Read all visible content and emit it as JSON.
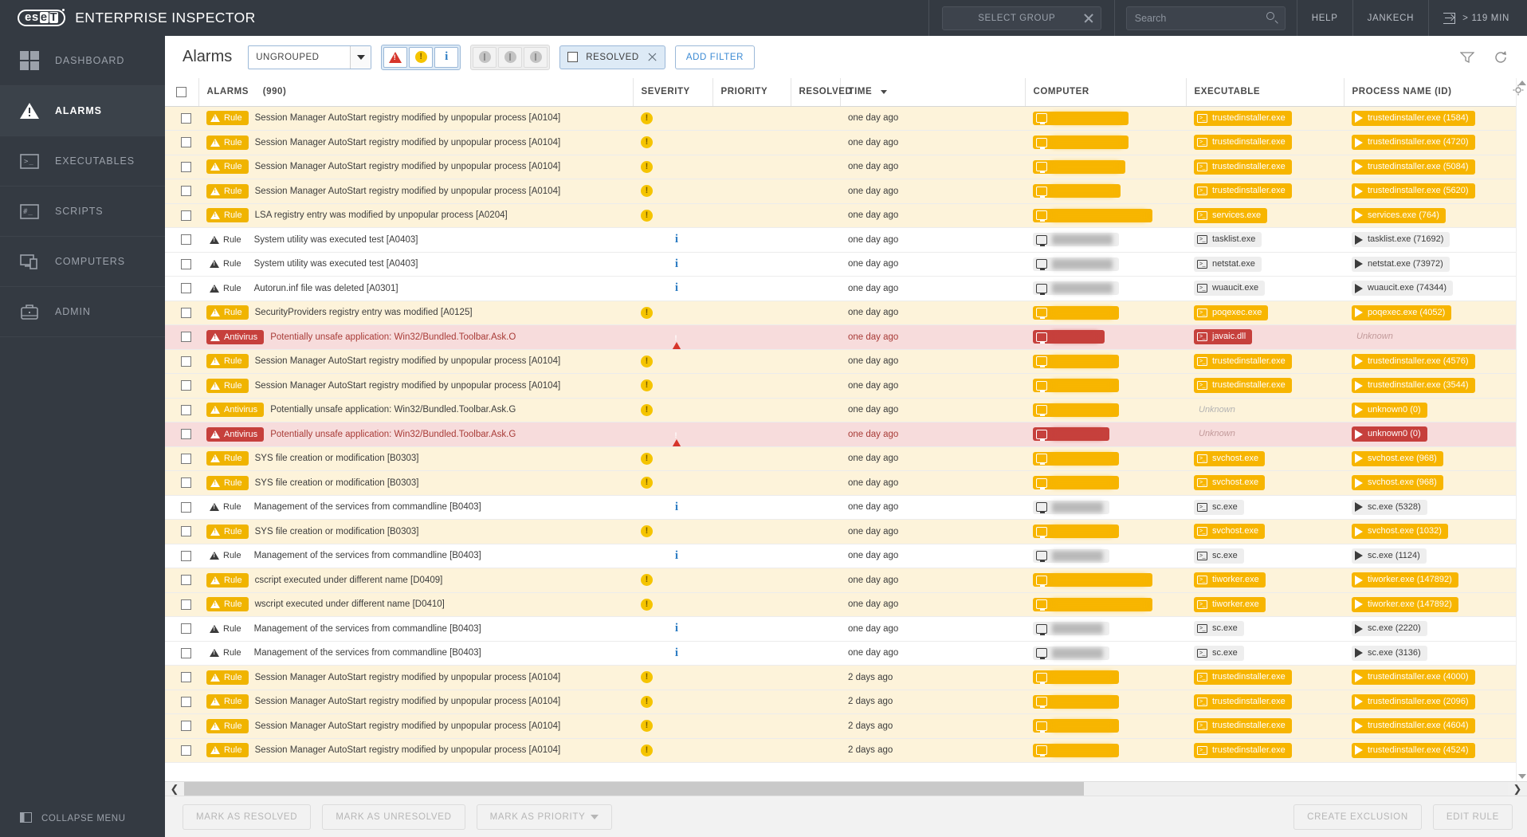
{
  "app": {
    "logo_text_1": "es",
    "logo_text_2": "e",
    "logo_text_3": "T",
    "title": "ENTERPRISE INSPECTOR"
  },
  "header": {
    "select_group_label": "SELECT GROUP",
    "search_placeholder": "Search",
    "search_value": "",
    "help_label": "HELP",
    "user_label": "JANKECH",
    "session_label": "> 119 MIN"
  },
  "sidebar": {
    "items": [
      {
        "label": "DASHBOARD",
        "icon": "grid-icon",
        "active": false
      },
      {
        "label": "ALARMS",
        "icon": "warning-triangle-icon",
        "active": true
      },
      {
        "label": "EXECUTABLES",
        "icon": "terminal-icon",
        "active": false
      },
      {
        "label": "SCRIPTS",
        "icon": "script-icon",
        "active": false
      },
      {
        "label": "COMPUTERS",
        "icon": "monitor-icon",
        "active": false
      },
      {
        "label": "ADMIN",
        "icon": "briefcase-icon",
        "active": false
      }
    ],
    "collapse_label": "COLLAPSE MENU"
  },
  "toolbar": {
    "page_title": "Alarms",
    "group_select_value": "UNGROUPED",
    "severity_buttons": [
      {
        "name": "severity-threat",
        "icon": "red-triangle-icon",
        "active": true
      },
      {
        "name": "severity-warning",
        "icon": "yellow-exclamation-icon",
        "active": true
      },
      {
        "name": "severity-info",
        "icon": "blue-info-icon",
        "active": true
      }
    ],
    "priority_buttons": [
      {
        "name": "priority-high",
        "icon": "gray-circle-icon",
        "active": false
      },
      {
        "name": "priority-medium",
        "icon": "gray-circle-icon",
        "active": false
      },
      {
        "name": "priority-low",
        "icon": "gray-circle-icon",
        "active": false
      }
    ],
    "resolved_filter": {
      "label": "RESOLVED",
      "checked": false
    },
    "add_filter_label": "ADD FILTER",
    "filter_icon": "funnel-icon",
    "refresh_icon": "refresh-icon"
  },
  "table": {
    "columns": [
      {
        "key": "alarms",
        "label": "ALARMS",
        "count": "(990)"
      },
      {
        "key": "severity",
        "label": "SEVERITY"
      },
      {
        "key": "priority",
        "label": "PRIORITY"
      },
      {
        "key": "resolved",
        "label": "RESOLVED"
      },
      {
        "key": "time",
        "label": "TIME",
        "sorted": "desc"
      },
      {
        "key": "computer",
        "label": "COMPUTER"
      },
      {
        "key": "executable",
        "label": "EXECUTABLE"
      },
      {
        "key": "process",
        "label": "PROCESS NAME (ID)"
      }
    ],
    "settings_icon": "gear-icon",
    "rows": [
      {
        "tone": "yellow",
        "tag": "Rule",
        "tag_style": "rule",
        "name": "Session Manager AutoStart registry modified by unpopular process [A0104]",
        "severity": "warning",
        "priority": "",
        "resolved": "",
        "time": "one day ago",
        "computer_redacted": 88,
        "computer_style": "y",
        "executable": "trustedinstaller.exe",
        "exec_style": "y",
        "process": "trustedinstaller.exe (1584)",
        "proc_style": "y"
      },
      {
        "tone": "yellow",
        "tag": "Rule",
        "tag_style": "rule",
        "name": "Session Manager AutoStart registry modified by unpopular process [A0104]",
        "severity": "warning",
        "priority": "",
        "resolved": "",
        "time": "one day ago",
        "computer_redacted": 88,
        "computer_style": "y",
        "executable": "trustedinstaller.exe",
        "exec_style": "y",
        "process": "trustedinstaller.exe (4720)",
        "proc_style": "y"
      },
      {
        "tone": "yellow",
        "tag": "Rule",
        "tag_style": "rule",
        "name": "Session Manager AutoStart registry modified by unpopular process [A0104]",
        "severity": "warning",
        "priority": "",
        "resolved": "",
        "time": "one day ago",
        "computer_redacted": 84,
        "computer_style": "y",
        "executable": "trustedinstaller.exe",
        "exec_style": "y",
        "process": "trustedinstaller.exe (5084)",
        "proc_style": "y"
      },
      {
        "tone": "yellow",
        "tag": "Rule",
        "tag_style": "rule",
        "name": "Session Manager AutoStart registry modified by unpopular process [A0104]",
        "severity": "warning",
        "priority": "",
        "resolved": "",
        "time": "one day ago",
        "computer_redacted": 78,
        "computer_style": "y",
        "executable": "trustedinstaller.exe",
        "exec_style": "y",
        "process": "trustedinstaller.exe (5620)",
        "proc_style": "y"
      },
      {
        "tone": "yellow",
        "tag": "Rule",
        "tag_style": "rule",
        "name": "LSA registry entry was modified by unpopular process [A0204]",
        "severity": "warning",
        "priority": "",
        "resolved": "",
        "time": "one day ago",
        "computer_redacted": 118,
        "computer_style": "y",
        "executable": "services.exe",
        "exec_style": "y",
        "process": "services.exe (764)",
        "proc_style": "y"
      },
      {
        "tone": "white",
        "tag": "Rule",
        "tag_style": "plain",
        "name": "System utility was executed test [A0403]",
        "severity": "info",
        "priority": "",
        "resolved": "",
        "time": "one day ago",
        "computer_redacted": 76,
        "computer_style": "g",
        "executable": "tasklist.exe",
        "exec_style": "g",
        "process": "tasklist.exe (71692)",
        "proc_style": "g"
      },
      {
        "tone": "white",
        "tag": "Rule",
        "tag_style": "plain",
        "name": "System utility was executed test [A0403]",
        "severity": "info",
        "priority": "",
        "resolved": "",
        "time": "one day ago",
        "computer_redacted": 76,
        "computer_style": "g",
        "executable": "netstat.exe",
        "exec_style": "g",
        "process": "netstat.exe (73972)",
        "proc_style": "g"
      },
      {
        "tone": "white",
        "tag": "Rule",
        "tag_style": "plain",
        "name": "Autorun.inf file was deleted [A0301]",
        "severity": "info",
        "priority": "",
        "resolved": "",
        "time": "one day ago",
        "computer_redacted": 76,
        "computer_style": "g",
        "executable": "wuaucit.exe",
        "exec_style": "g",
        "process": "wuaucit.exe (74344)",
        "proc_style": "g"
      },
      {
        "tone": "yellow",
        "tag": "Rule",
        "tag_style": "rule",
        "name": "SecurityProviders registry entry was modified [A0125]",
        "severity": "warning",
        "priority": "",
        "resolved": "",
        "time": "one day ago",
        "computer_redacted": 76,
        "computer_style": "y",
        "executable": "poqexec.exe",
        "exec_style": "y",
        "process": "poqexec.exe (4052)",
        "proc_style": "y"
      },
      {
        "tone": "red",
        "tag": "Antivirus",
        "tag_style": "av-r",
        "name": "Potentially unsafe application: Win32/Bundled.Toolbar.Ask.O",
        "severity": "threat",
        "priority": "",
        "resolved": "",
        "time": "one day ago",
        "computer_redacted": 58,
        "computer_style": "r",
        "executable": "javaic.dll",
        "exec_style": "r",
        "process": "Unknown",
        "proc_style": "none"
      },
      {
        "tone": "yellow",
        "tag": "Rule",
        "tag_style": "rule",
        "name": "Session Manager AutoStart registry modified by unpopular process [A0104]",
        "severity": "warning",
        "priority": "",
        "resolved": "",
        "time": "one day ago",
        "computer_redacted": 76,
        "computer_style": "y",
        "executable": "trustedinstaller.exe",
        "exec_style": "y",
        "process": "trustedinstaller.exe (4576)",
        "proc_style": "y"
      },
      {
        "tone": "yellow",
        "tag": "Rule",
        "tag_style": "rule",
        "name": "Session Manager AutoStart registry modified by unpopular process [A0104]",
        "severity": "warning",
        "priority": "",
        "resolved": "",
        "time": "one day ago",
        "computer_redacted": 76,
        "computer_style": "y",
        "executable": "trustedinstaller.exe",
        "exec_style": "y",
        "process": "trustedinstaller.exe (3544)",
        "proc_style": "y"
      },
      {
        "tone": "yellow",
        "tag": "Antivirus",
        "tag_style": "av-y",
        "name": "Potentially unsafe application: Win32/Bundled.Toolbar.Ask.G",
        "severity": "warning",
        "priority": "",
        "resolved": "",
        "time": "one day ago",
        "computer_redacted": 76,
        "computer_style": "y",
        "executable": "Unknown",
        "exec_style": "none",
        "process": "unknown0 (0)",
        "proc_style": "y"
      },
      {
        "tone": "red",
        "tag": "Antivirus",
        "tag_style": "av-r",
        "name": "Potentially unsafe application: Win32/Bundled.Toolbar.Ask.G",
        "severity": "threat",
        "priority": "",
        "resolved": "",
        "time": "one day ago",
        "computer_redacted": 64,
        "computer_style": "r",
        "executable": "Unknown",
        "exec_style": "none",
        "process": "unknown0 (0)",
        "proc_style": "r"
      },
      {
        "tone": "yellow",
        "tag": "Rule",
        "tag_style": "rule",
        "name": "SYS file creation or modification [B0303]",
        "severity": "warning",
        "priority": "",
        "resolved": "",
        "time": "one day ago",
        "computer_redacted": 76,
        "computer_style": "y",
        "executable": "svchost.exe",
        "exec_style": "y",
        "process": "svchost.exe (968)",
        "proc_style": "y"
      },
      {
        "tone": "yellow",
        "tag": "Rule",
        "tag_style": "rule",
        "name": "SYS file creation or modification [B0303]",
        "severity": "warning",
        "priority": "",
        "resolved": "",
        "time": "one day ago",
        "computer_redacted": 76,
        "computer_style": "y",
        "executable": "svchost.exe",
        "exec_style": "y",
        "process": "svchost.exe (968)",
        "proc_style": "y"
      },
      {
        "tone": "white",
        "tag": "Rule",
        "tag_style": "plain",
        "name": "Management of the services from commandline [B0403]",
        "severity": "info",
        "priority": "",
        "resolved": "",
        "time": "one day ago",
        "computer_redacted": 64,
        "computer_style": "g",
        "executable": "sc.exe",
        "exec_style": "g",
        "process": "sc.exe (5328)",
        "proc_style": "g"
      },
      {
        "tone": "yellow",
        "tag": "Rule",
        "tag_style": "rule",
        "name": "SYS file creation or modification [B0303]",
        "severity": "warning",
        "priority": "",
        "resolved": "",
        "time": "one day ago",
        "computer_redacted": 76,
        "computer_style": "y",
        "executable": "svchost.exe",
        "exec_style": "y",
        "process": "svchost.exe (1032)",
        "proc_style": "y"
      },
      {
        "tone": "white",
        "tag": "Rule",
        "tag_style": "plain",
        "name": "Management of the services from commandline [B0403]",
        "severity": "info",
        "priority": "",
        "resolved": "",
        "time": "one day ago",
        "computer_redacted": 64,
        "computer_style": "g",
        "executable": "sc.exe",
        "exec_style": "g",
        "process": "sc.exe (1124)",
        "proc_style": "g"
      },
      {
        "tone": "yellow",
        "tag": "Rule",
        "tag_style": "rule",
        "name": "cscript executed under different name [D0409]",
        "severity": "warning",
        "priority": "",
        "resolved": "",
        "time": "one day ago",
        "computer_redacted": 118,
        "computer_style": "y",
        "executable": "tiworker.exe",
        "exec_style": "y",
        "process": "tiworker.exe (147892)",
        "proc_style": "y"
      },
      {
        "tone": "yellow",
        "tag": "Rule",
        "tag_style": "rule",
        "name": "wscript executed under different name [D0410]",
        "severity": "warning",
        "priority": "",
        "resolved": "",
        "time": "one day ago",
        "computer_redacted": 118,
        "computer_style": "y",
        "executable": "tiworker.exe",
        "exec_style": "y",
        "process": "tiworker.exe (147892)",
        "proc_style": "y"
      },
      {
        "tone": "white",
        "tag": "Rule",
        "tag_style": "plain",
        "name": "Management of the services from commandline [B0403]",
        "severity": "info",
        "priority": "",
        "resolved": "",
        "time": "one day ago",
        "computer_redacted": 64,
        "computer_style": "g",
        "executable": "sc.exe",
        "exec_style": "g",
        "process": "sc.exe (2220)",
        "proc_style": "g"
      },
      {
        "tone": "white",
        "tag": "Rule",
        "tag_style": "plain",
        "name": "Management of the services from commandline [B0403]",
        "severity": "info",
        "priority": "",
        "resolved": "",
        "time": "one day ago",
        "computer_redacted": 64,
        "computer_style": "g",
        "executable": "sc.exe",
        "exec_style": "g",
        "process": "sc.exe (3136)",
        "proc_style": "g"
      },
      {
        "tone": "yellow",
        "tag": "Rule",
        "tag_style": "rule",
        "name": "Session Manager AutoStart registry modified by unpopular process [A0104]",
        "severity": "warning",
        "priority": "",
        "resolved": "",
        "time": "2 days ago",
        "computer_redacted": 76,
        "computer_style": "y",
        "executable": "trustedinstaller.exe",
        "exec_style": "y",
        "process": "trustedinstaller.exe (4000)",
        "proc_style": "y"
      },
      {
        "tone": "yellow",
        "tag": "Rule",
        "tag_style": "rule",
        "name": "Session Manager AutoStart registry modified by unpopular process [A0104]",
        "severity": "warning",
        "priority": "",
        "resolved": "",
        "time": "2 days ago",
        "computer_redacted": 76,
        "computer_style": "y",
        "executable": "trustedinstaller.exe",
        "exec_style": "y",
        "process": "trustedinstaller.exe (2096)",
        "proc_style": "y"
      },
      {
        "tone": "yellow",
        "tag": "Rule",
        "tag_style": "rule",
        "name": "Session Manager AutoStart registry modified by unpopular process [A0104]",
        "severity": "warning",
        "priority": "",
        "resolved": "",
        "time": "2 days ago",
        "computer_redacted": 76,
        "computer_style": "y",
        "executable": "trustedinstaller.exe",
        "exec_style": "y",
        "process": "trustedinstaller.exe (4604)",
        "proc_style": "y"
      },
      {
        "tone": "yellow",
        "tag": "Rule",
        "tag_style": "rule",
        "name": "Session Manager AutoStart registry modified by unpopular process [A0104]",
        "severity": "warning",
        "priority": "",
        "resolved": "",
        "time": "2 days ago",
        "computer_redacted": 76,
        "computer_style": "y",
        "executable": "trustedinstaller.exe",
        "exec_style": "y",
        "process": "trustedinstaller.exe (4524)",
        "proc_style": "y"
      }
    ]
  },
  "footer": {
    "mark_resolved_label": "MARK AS RESOLVED",
    "mark_unresolved_label": "MARK AS UNRESOLVED",
    "mark_priority_label": "MARK AS PRIORITY",
    "create_exclusion_label": "CREATE EXCLUSION",
    "edit_rule_label": "EDIT RULE"
  },
  "colors": {
    "dark": "#343a42",
    "accent_yellow": "#f0b400",
    "accent_red": "#c6403c",
    "accent_blue": "#3b8ad4"
  }
}
